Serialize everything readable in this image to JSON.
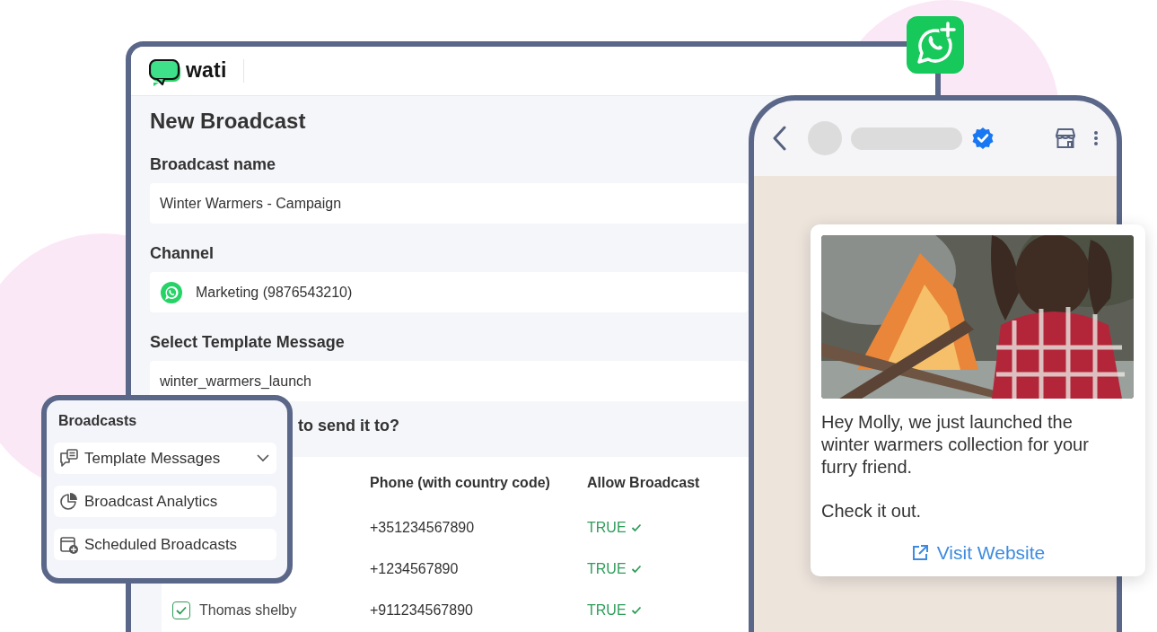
{
  "app": {
    "logo_text": "wati"
  },
  "form": {
    "title": "New Broadcast",
    "fields": [
      {
        "label": "Broadcast name",
        "value": "Winter Warmers - Campaign",
        "kind": "text"
      },
      {
        "label": "Channel",
        "value": "Marketing (9876543210)",
        "kind": "channel"
      },
      {
        "label": "Select Template Message",
        "value": "winter_warmers_launch",
        "kind": "text"
      }
    ],
    "question": "to send it to?"
  },
  "table": {
    "columns": [
      "Phone (with country code)",
      "Allow Broadcast"
    ],
    "rows": [
      {
        "phone": "+351234567890",
        "allow": "TRUE"
      },
      {
        "phone": "+1234567890",
        "allow": "TRUE"
      },
      {
        "name": "Thomas shelby",
        "checked": true,
        "phone": "+911234567890",
        "allow": "TRUE"
      }
    ]
  },
  "menu": {
    "title": "Broadcasts",
    "items": [
      {
        "label": "Template Messages",
        "kind": "group",
        "expanded": false
      },
      {
        "label": "Broadcast Analytics",
        "kind": "link"
      },
      {
        "label": "Scheduled Broadcasts",
        "kind": "link"
      }
    ]
  },
  "phone": {
    "verified": true,
    "message": {
      "image": {
        "kind": "picture"
      },
      "paragraphs": [
        "Hey Molly, we just launched the winter warmers collection for your furry friend.",
        "Check it out."
      ],
      "link": "Visit Website"
    }
  }
}
